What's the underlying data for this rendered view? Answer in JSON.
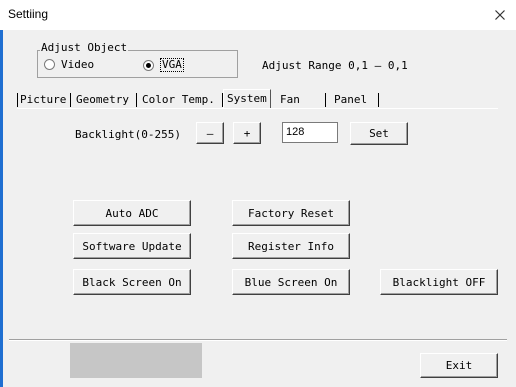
{
  "window": {
    "title": "Settiing",
    "close_glyph": "×"
  },
  "adjust_object": {
    "legend": "Adjust Object",
    "options": [
      {
        "label": "Video",
        "checked": false
      },
      {
        "label": "VGA",
        "checked": true
      }
    ],
    "range_label": "Adjust Range 0,1 — 0,1"
  },
  "tabs": [
    "Picture",
    "Geometry",
    "Color Temp.",
    "System",
    "Fan",
    "Panel"
  ],
  "active_tab": "System",
  "system": {
    "backlight_label": "Backlight(0-255)",
    "minus_label": "—",
    "plus_label": "+",
    "backlight_value": "128",
    "set_label": "Set",
    "buttons": {
      "auto_adc": "Auto ADC",
      "factory_reset": "Factory Reset",
      "software_update": "Software Update",
      "register_info": "Register Info",
      "black_screen_on": "Black Screen On",
      "blue_screen_on": "Blue Screen On",
      "blacklight_off": "Blacklight OFF"
    }
  },
  "footer": {
    "exit_label": "Exit"
  },
  "colors": {
    "window_bg": "#f0f0f0",
    "titlebar_bg": "#ffffff",
    "left_accent": "#1f6fd1",
    "progress_gray": "#c6c6c6"
  },
  "icons": {
    "close": "close-icon",
    "radio": "radio-icon"
  }
}
